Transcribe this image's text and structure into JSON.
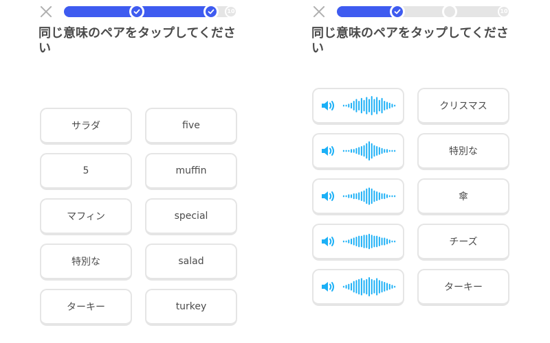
{
  "left": {
    "progress": {
      "fraction": 0.85,
      "total_label": "10",
      "checkpoints": [
        0.42,
        0.85
      ],
      "checkpoints_done": [
        true,
        true
      ]
    },
    "prompt": "同じ意味のペアをタップしてください",
    "tiles_col1": [
      "サラダ",
      "5",
      "マフィン",
      "特別な",
      "ターキー"
    ],
    "tiles_col2": [
      "five",
      "muffin",
      "special",
      "salad",
      "turkey"
    ]
  },
  "right": {
    "progress": {
      "fraction": 0.35,
      "total_label": "10",
      "checkpoints": [
        0.35,
        0.65
      ],
      "checkpoints_done": [
        true,
        false
      ]
    },
    "prompt": "同じ意味のペアをタップしてください",
    "audio_tiles": [
      "speaker-icon",
      "speaker-icon",
      "speaker-icon",
      "speaker-icon",
      "speaker-icon"
    ],
    "tiles_col2": [
      "クリスマス",
      "特別な",
      "傘",
      "チーズ",
      "ターキー"
    ]
  },
  "colors": {
    "accent": "#3e5bf0",
    "audio": "#1cb0f6",
    "track": "#e5e5e5",
    "border": "#e5e5e5",
    "text": "#4b4b4b"
  }
}
